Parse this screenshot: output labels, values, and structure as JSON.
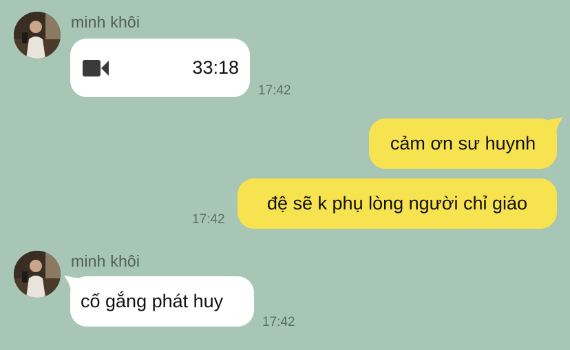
{
  "messages": [
    {
      "sender": "minh khôi",
      "type": "video_call",
      "duration": "33:18",
      "time": "17:42",
      "icon": "video-camera-icon"
    },
    {
      "from": "me",
      "text": "cảm ơn sư huynh"
    },
    {
      "from": "me",
      "text": "đệ sẽ k phụ lòng người chỉ giáo",
      "time": "17:42"
    },
    {
      "sender": "minh khôi",
      "text": "cố gắng phát huy",
      "time": "17:42"
    }
  ],
  "colors": {
    "background": "#a7c6b5",
    "incoming_bubble": "#ffffff",
    "outgoing_bubble": "#f7e24f"
  }
}
